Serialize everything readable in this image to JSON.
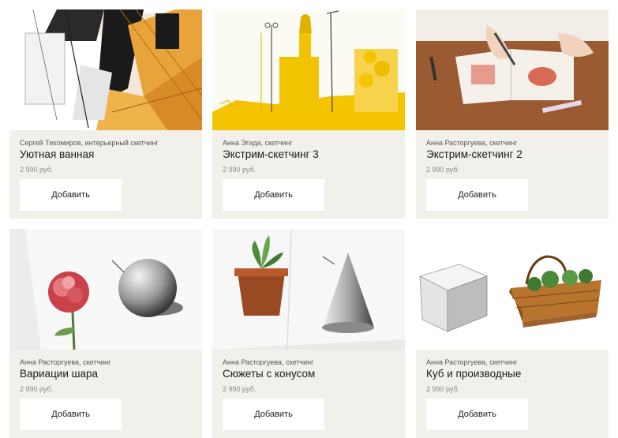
{
  "products": [
    {
      "author": "Сергей Тихомиров, интерьерный скетчинг",
      "title": "Уютная ванная",
      "price": "2 990 руб.",
      "button": "Добавить"
    },
    {
      "author": "Анна Эгида, скетчинг",
      "title": "Экстрим-скетчинг 3",
      "price": "2 990 руб.",
      "button": "Добавить"
    },
    {
      "author": "Анна Расторгуева, скетчинг",
      "title": "Экстрим-скетчинг 2",
      "price": "2 990 руб.",
      "button": "Добавить"
    },
    {
      "author": "Анна Расторгуева, скетчинг",
      "title": "Вариации шара",
      "price": "2 990 руб.",
      "button": "Добавить"
    },
    {
      "author": "Анна Расторгуева, скетчинг",
      "title": "Сюжеты с конусом",
      "price": "2 990 руб.",
      "button": "Добавить"
    },
    {
      "author": "Анна Расторгуева, скетчинг",
      "title": "Куб и производные",
      "price": "2 990 руб.",
      "button": "Добавить"
    }
  ],
  "colors": {
    "card_bg": "#f1f0ea",
    "button_bg": "#ffffff",
    "accent_yellow": "#f2c600"
  },
  "images": [
    "interior-sketch-bathroom",
    "yellow-city-sketch",
    "hands-sketchbook",
    "peony-and-sphere",
    "cactus-and-cone",
    "cube-and-planter-box"
  ]
}
